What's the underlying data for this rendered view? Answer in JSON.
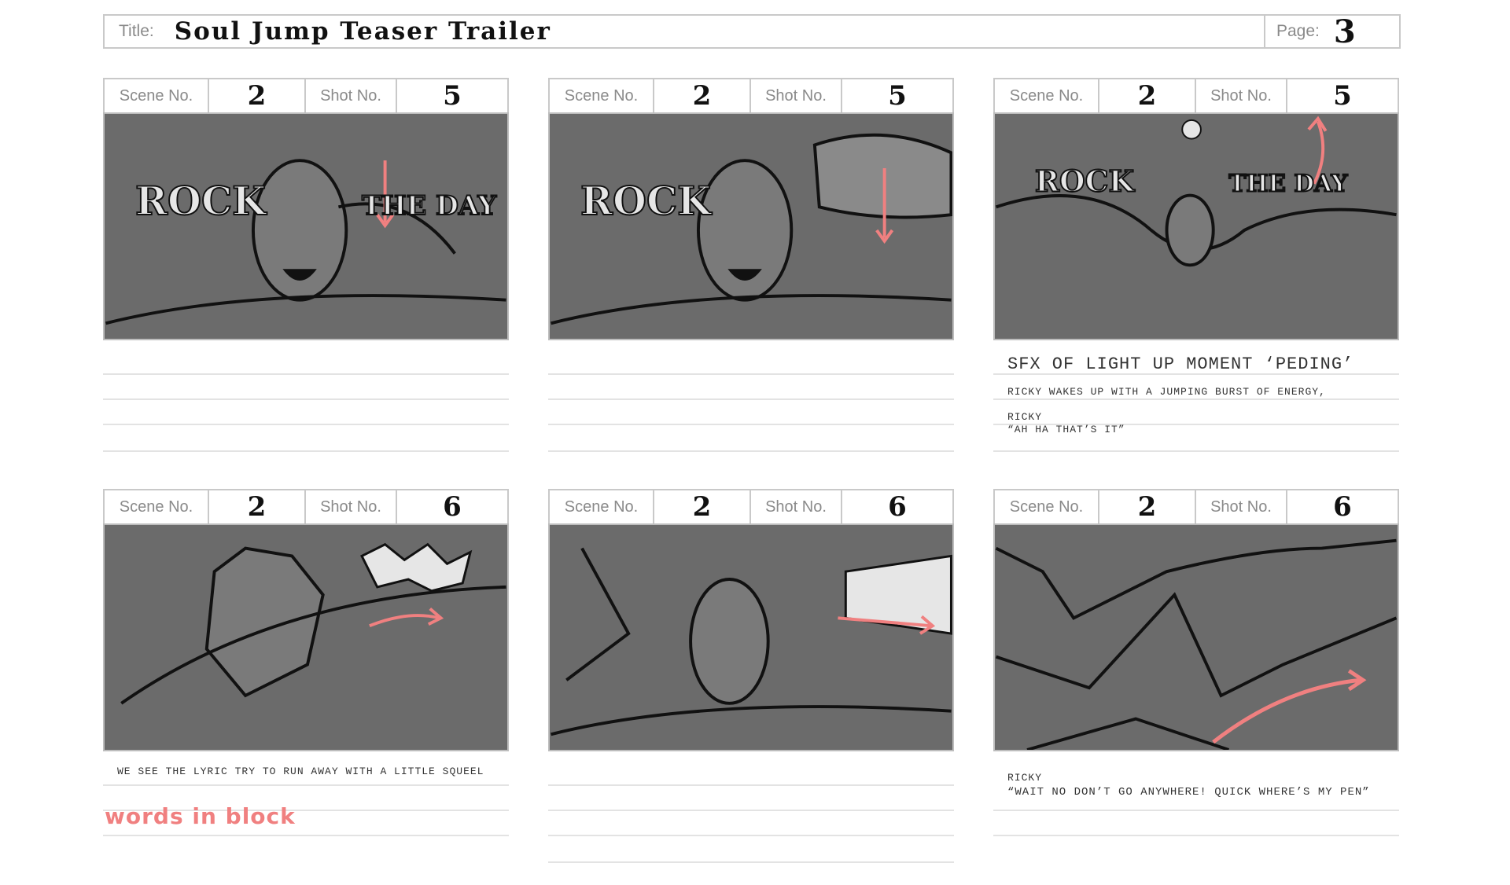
{
  "header": {
    "title_label": "Title:",
    "title": "Soul Jump Teaser Trailer",
    "page_label": "Page:",
    "page": "3"
  },
  "labels": {
    "scene": "Scene No.",
    "shot": "Shot No."
  },
  "panels": [
    {
      "scene": "2",
      "shot": "5",
      "frame_text_left": "ROCK",
      "frame_text_right": "THE DAY",
      "notes": []
    },
    {
      "scene": "2",
      "shot": "5",
      "frame_text_left": "ROCK",
      "frame_text_right": "",
      "notes": []
    },
    {
      "scene": "2",
      "shot": "5",
      "frame_text_left": "ROCK",
      "frame_text_right": "THE DAY",
      "notes": [
        "SFX OF LIGHT UP MOMENT ‘PEDING’",
        "RICKY WAKES UP WITH A JUMPING BURST OF ENERGY,",
        "RICKY",
        "“AH HA THAT’S IT”"
      ]
    },
    {
      "scene": "2",
      "shot": "6",
      "notes": [
        "WE SEE THE LYRIC TRY TO RUN AWAY WITH A LITTLE SQUEEL",
        "words in block"
      ]
    },
    {
      "scene": "2",
      "shot": "6",
      "notes": []
    },
    {
      "scene": "2",
      "shot": "6",
      "notes": [
        "RICKY",
        "“WAIT NO DON’T GO ANYWHERE! QUICK WHERE’S MY PEN”"
      ]
    }
  ],
  "colors": {
    "frame_fill": "#6b6b6b",
    "ink": "#111111",
    "arrow": "#f08080",
    "rule": "#e3e3e3"
  }
}
